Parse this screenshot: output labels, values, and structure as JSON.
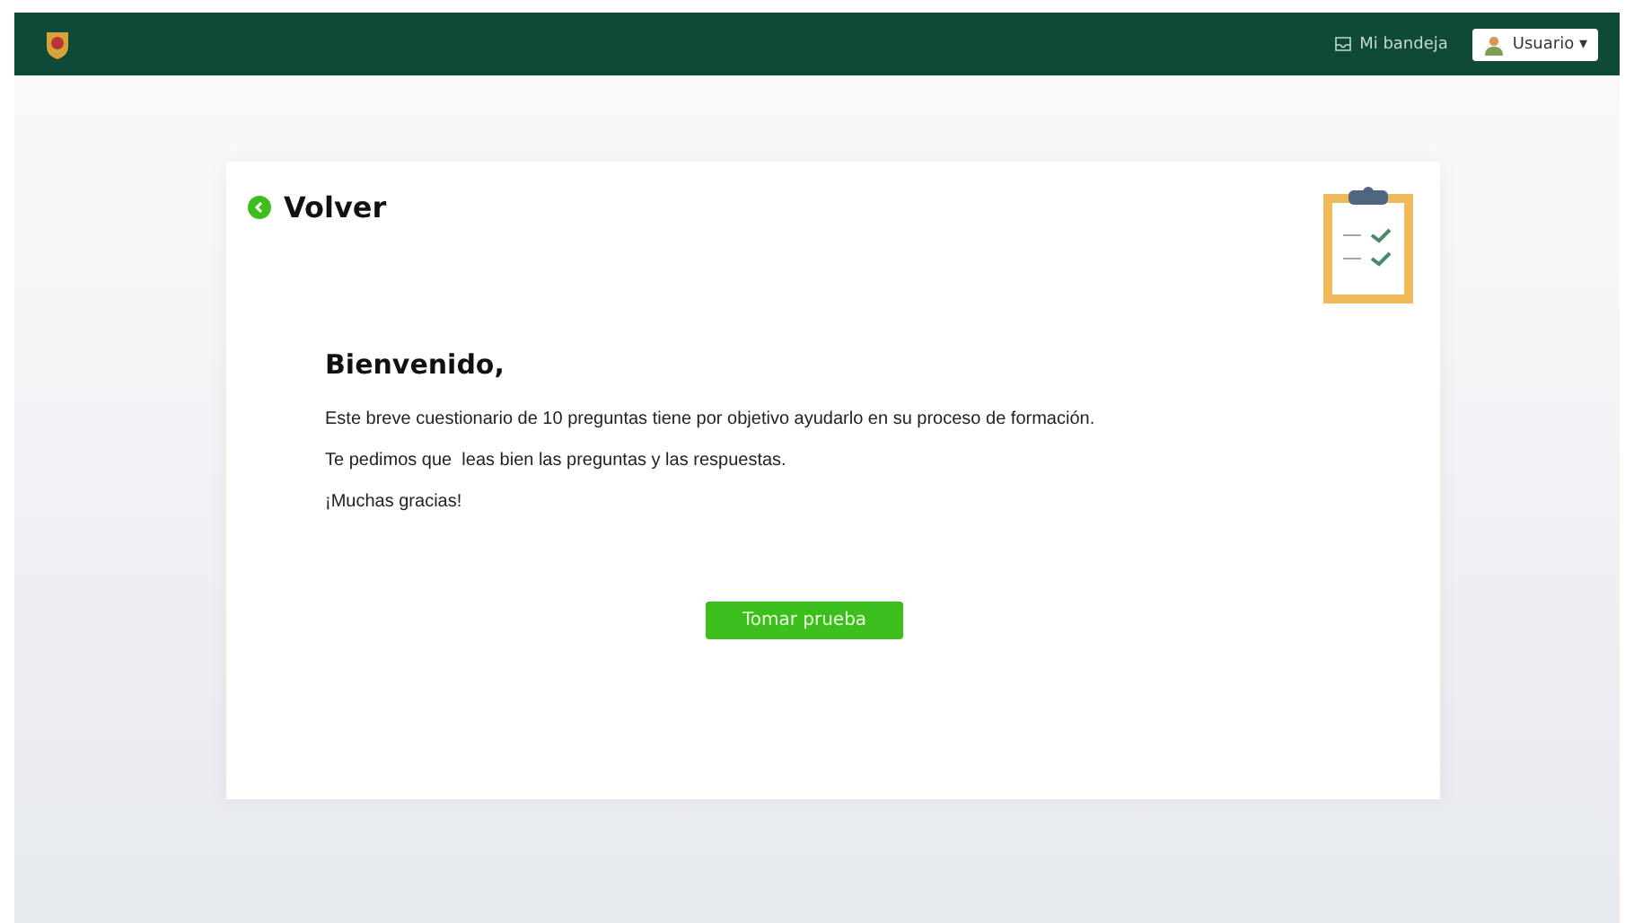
{
  "header": {
    "inbox_link": "Mi bandeja",
    "user_menu": "Usuario ▾"
  },
  "back_link": "Volver",
  "welcome": {
    "title": "Bienvenido,",
    "paragraphs": [
      "Este breve cuestionario de 10 preguntas tiene por objetivo ayudarlo en su proceso de formación.",
      "Te pedimos que  leas bien las preguntas y las respuestas.",
      "¡Muchas gracias!"
    ]
  },
  "start_button": "Tomar prueba"
}
